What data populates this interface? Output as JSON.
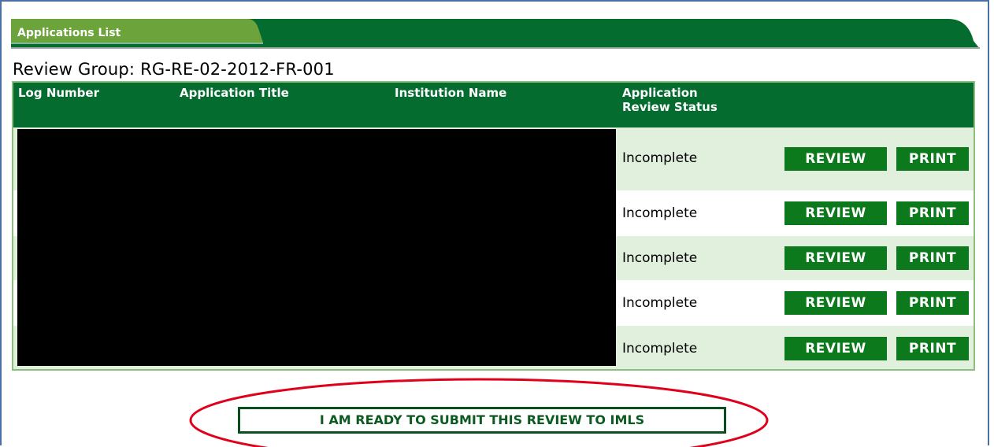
{
  "panel": {
    "tab_title": "Applications List",
    "review_group_label": "Review Group:",
    "review_group_value": "RG-RE-02-2012-FR-001"
  },
  "table": {
    "columns": {
      "log_number": "Log Number",
      "application_title": "Application Title",
      "institution_name": "Institution Name",
      "review_status_line1": "Application",
      "review_status_line2": "Review Status"
    },
    "rows": [
      {
        "status": "Incomplete",
        "review_label": "REVIEW",
        "print_label": "PRINT"
      },
      {
        "status": "Incomplete",
        "review_label": "REVIEW",
        "print_label": "PRINT"
      },
      {
        "status": "Incomplete",
        "review_label": "REVIEW",
        "print_label": "PRINT"
      },
      {
        "status": "Incomplete",
        "review_label": "REVIEW",
        "print_label": "PRINT"
      },
      {
        "status": "Incomplete",
        "review_label": "REVIEW",
        "print_label": "PRINT"
      }
    ]
  },
  "submit": {
    "label": "I AM READY TO SUBMIT THIS REVIEW TO IMLS"
  },
  "colors": {
    "header_green": "#046c2e",
    "tab_green": "#6ca33a",
    "button_green": "#0c7a1c",
    "row_alt": "#e1efdd",
    "annotation_red": "#e0001b"
  }
}
